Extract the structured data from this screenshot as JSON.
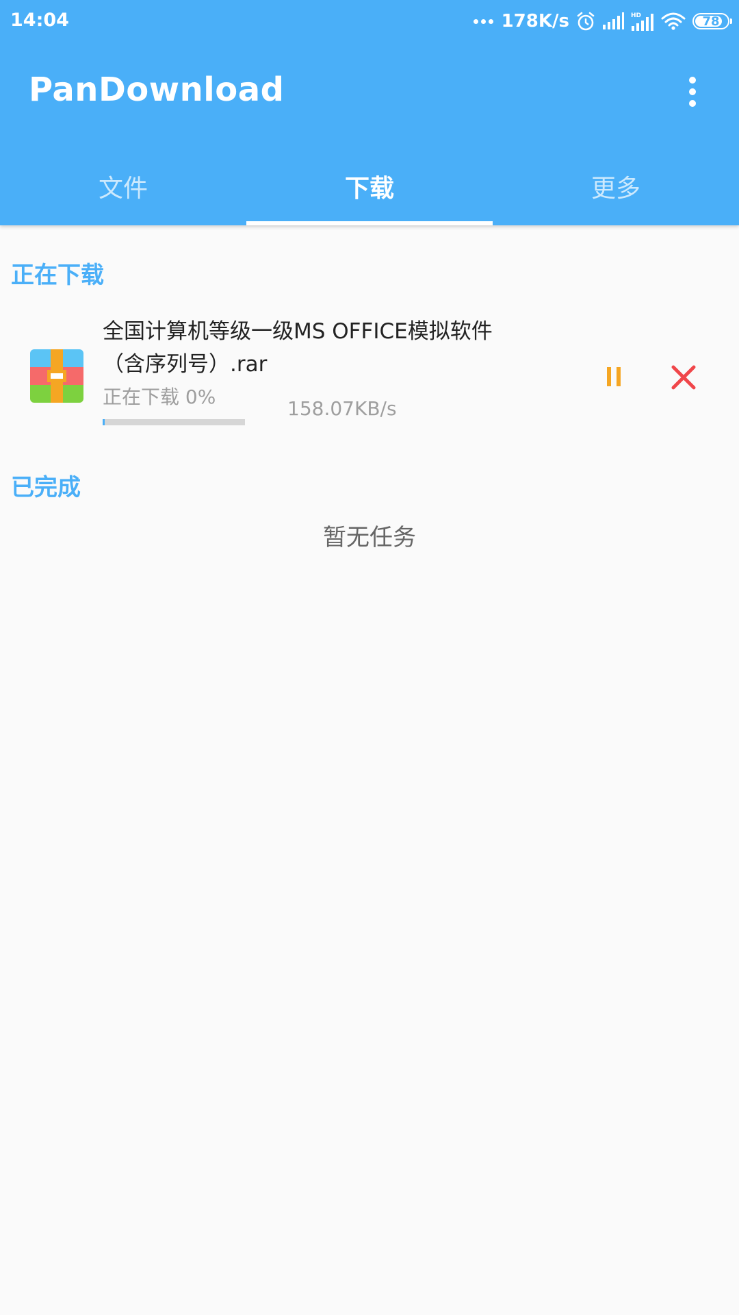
{
  "status_bar": {
    "time": "14:04",
    "net_speed": "178K/s",
    "battery": "78",
    "battery_level": 0.78,
    "hd_label": "HD"
  },
  "app_bar": {
    "title": "PanDownload",
    "overflow_icon": "more-vert-icon"
  },
  "tabs": [
    {
      "label": "文件",
      "active": false
    },
    {
      "label": "下载",
      "active": true
    },
    {
      "label": "更多",
      "active": false
    }
  ],
  "downloading": {
    "title": "正在下载",
    "items": [
      {
        "file_name": "全国计算机等级一级MS OFFICE模拟软件（含序列号）.rar",
        "status": "正在下载 0%",
        "progress": 0.01,
        "speed": "158.07KB/s",
        "icon": "archive-file-icon"
      }
    ]
  },
  "completed": {
    "title": "已完成",
    "empty_text": "暂无任务"
  },
  "colors": {
    "primary": "#4aaff8",
    "pause": "#f5a623",
    "cancel": "#f0464a"
  }
}
